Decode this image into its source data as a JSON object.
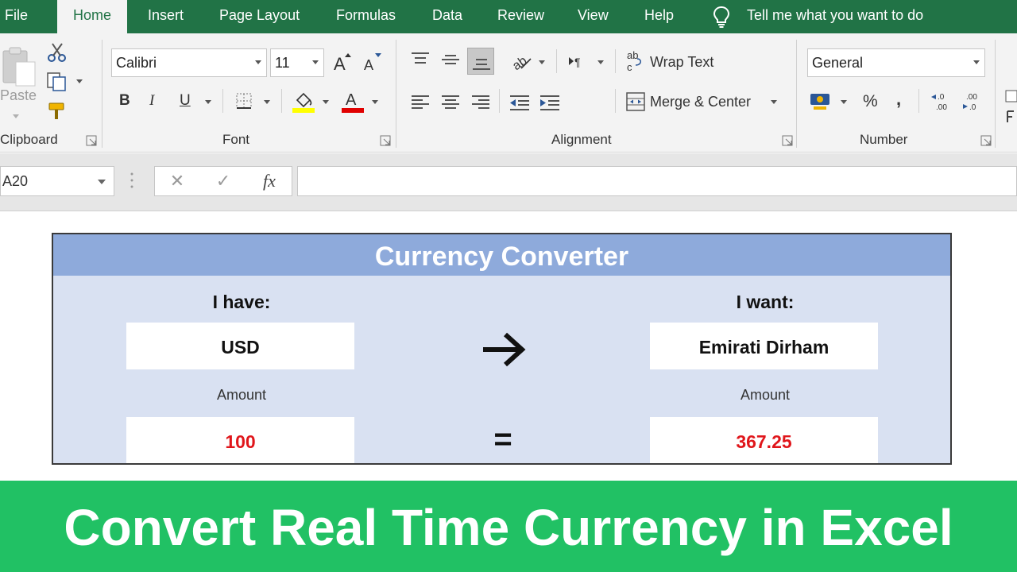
{
  "ribbon_tabs": [
    {
      "label": "File"
    },
    {
      "label": "Home"
    },
    {
      "label": "Insert"
    },
    {
      "label": "Page Layout"
    },
    {
      "label": "Formulas"
    },
    {
      "label": "Data"
    },
    {
      "label": "Review"
    },
    {
      "label": "View"
    },
    {
      "label": "Help"
    }
  ],
  "active_tab": "Home",
  "tell_me": "Tell me what you want to do",
  "clipboard": {
    "paste_label": "Paste",
    "group_label": "Clipboard"
  },
  "font": {
    "family": "Calibri",
    "size": "11",
    "bold": "B",
    "italic": "I",
    "underline": "U",
    "group_label": "Font",
    "highlight_color": "#ffff00",
    "font_color": "#e00000"
  },
  "alignment": {
    "wrap_text": "Wrap Text",
    "merge_center": "Merge & Center",
    "group_label": "Alignment"
  },
  "number": {
    "format": "General",
    "percent": "%",
    "comma": ",",
    "group_label": "Number"
  },
  "formula_bar": {
    "name_box": "A20",
    "cancel": "✕",
    "enter": "✓",
    "fx": "fx",
    "formula": ""
  },
  "converter": {
    "title": "Currency Converter",
    "have_label": "I have:",
    "want_label": "I want:",
    "from_currency": "USD",
    "to_currency": "Emirati Dirham",
    "amount_label_left": "Amount",
    "amount_label_right": "Amount",
    "from_amount": "100",
    "to_amount": "367.25",
    "equals": "="
  },
  "banner": {
    "text": "Convert Real Time Currency in Excel"
  },
  "colors": {
    "excel_green": "#217346",
    "header_blue": "#8eaadb",
    "body_blue": "#d9e1f2",
    "amount_red": "#e0161b",
    "banner_green": "#21c164"
  }
}
